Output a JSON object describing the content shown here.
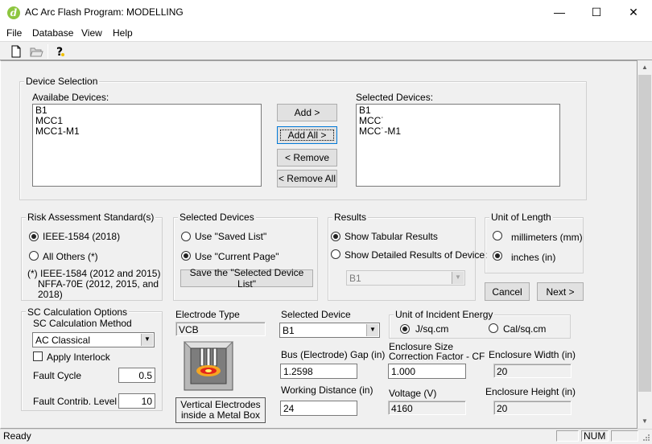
{
  "window": {
    "title": "AC Arc Flash Program: MODELLING",
    "app_icon_glyph": "d",
    "minimize": "—",
    "maximize": "☐",
    "close": "✕"
  },
  "menu": [
    "File",
    "Database",
    "View",
    "Help"
  ],
  "toolbar": {
    "icons": [
      "new-file-icon",
      "open-folder-icon",
      "help-icon"
    ]
  },
  "device_selection": {
    "legend": "Device Selection",
    "available_label": "Availabe Devices:",
    "available": [
      "B1",
      "MCC1",
      "MCC1-M1"
    ],
    "selected_label": "Selected Devices:",
    "selected": [
      "B1",
      "MCC˙",
      "MCC˙-M1"
    ],
    "add": "Add >",
    "add_all": "Add All >",
    "remove": "< Remove",
    "remove_all": "< Remove All"
  },
  "risk": {
    "legend": "Risk Assessment Standard(s)",
    "option1": "IEEE-1584 (2018)",
    "option2": "All Others (*)",
    "note1": "(*) IEEE-1584 (2012 and 2015)",
    "note2": "NFFA-70E (2012, 2015, and",
    "note3": "2018)"
  },
  "selected_devices_group": {
    "legend": "Selected Devices",
    "option1": "Use \"Saved List\"",
    "option2": "Use \"Current Page\"",
    "save_button": "Save the \"Selected Device List\""
  },
  "results": {
    "legend": "Results",
    "option1": "Show Tabular Results",
    "option2": "Show Detailed Results of Device:",
    "device_value": "B1"
  },
  "unit_length": {
    "legend": "Unit of Length",
    "option1": "millimeters (mm)",
    "option2": "inches (in)"
  },
  "nav": {
    "cancel": "Cancel",
    "next": "Next >"
  },
  "sc_calc": {
    "legend": "SC Calculation Options",
    "method_label": "SC Calculation Method",
    "method_value": "AC Classical",
    "apply_interlock": "Apply Interlock",
    "fault_cycle_label": "Fault Cycle",
    "fault_cycle_value": "0.5",
    "fault_contrib_label": "Fault Contrib. Level",
    "fault_contrib_value": "10"
  },
  "electrode": {
    "type_label": "Electrode Type",
    "type_value": "VCB",
    "description_line1": "Vertical Electrodes",
    "description_line2": "inside a Metal Box"
  },
  "device": {
    "label": "Selected Device",
    "value": "B1",
    "gap_label": "Bus (Electrode) Gap (in)",
    "gap_value": "1.2598",
    "working_distance_label": "Working Distance (in)",
    "working_distance_value": "24"
  },
  "incident_energy": {
    "legend": "Unit of Incident Energy",
    "option1": "J/sq.cm",
    "option2": "Cal/sq.cm"
  },
  "enclosure": {
    "cf_label_line1": "Enclosure Size",
    "cf_label_line2": "Correction Factor - CF",
    "cf_value": "1.000",
    "voltage_label": "Voltage (V)",
    "voltage_value": "4160",
    "width_label": "Enclosure Width (in)",
    "width_value": "20",
    "height_label": "Enclosure Height (in)",
    "height_value": "20"
  },
  "status": {
    "text": "Ready",
    "num": "NUM"
  },
  "colors": {
    "accent": "#0078d7",
    "app_icon": "#8dc63f",
    "flame": "#f5a623"
  }
}
